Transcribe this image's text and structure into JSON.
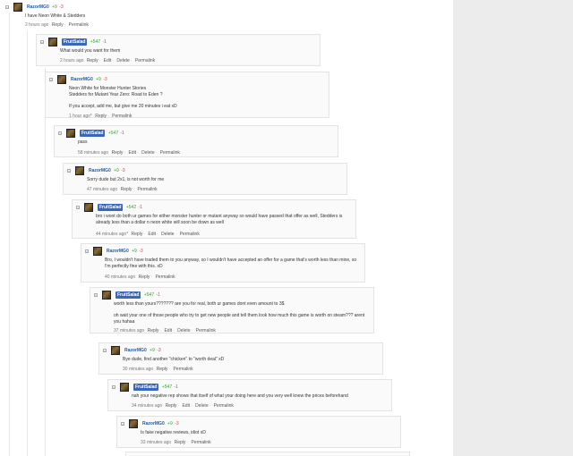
{
  "comments": [
    {
      "user": "RazorMG0",
      "pos": "+9",
      "neg": "-3",
      "text": [
        "I have Neon White & Stedders"
      ],
      "time": "2 hours ago",
      "actions": [
        "Reply",
        "Permalink"
      ]
    },
    {
      "user": "FruitSalad",
      "pos": "+547",
      "neg": "-1",
      "text": [
        "What would you want for them"
      ],
      "time": "2 hours ago",
      "actions": [
        "Reply",
        "Edit",
        "Delete",
        "Permalink"
      ]
    },
    {
      "user": "RazorMG0",
      "pos": "+9",
      "neg": "-3",
      "text": [
        "Neon White for Monster Hunter Stories",
        "Stedders for Mutant Year Zero: Road to Eden ?",
        "",
        "If you accept, add me, but give me 20 minutes i eat xD"
      ],
      "time": "1 hour ago*",
      "actions": [
        "Reply",
        "Permalink"
      ]
    },
    {
      "user": "FruitSalad",
      "pos": "+547",
      "neg": "-1",
      "text": [
        "pass"
      ],
      "time": "58 minutes ago",
      "actions": [
        "Reply",
        "Edit",
        "Delete",
        "Permalink"
      ]
    },
    {
      "user": "RazorMG0",
      "pos": "+9",
      "neg": "-3",
      "text": [
        "Sorry dude but 2x1, is not worth for me"
      ],
      "time": "47 minutes ago",
      "actions": [
        "Reply",
        "Permalink"
      ]
    },
    {
      "user": "FruitSalad",
      "pos": "+542",
      "neg": "-1",
      "text": [
        "bro i wont do both ur games for either monster hunter or mutant anyway so would have passed that offer as well, Stedders is already less than a dollar n neon white will soon be down as well"
      ],
      "time": "44 minutes ago*",
      "actions": [
        "Reply",
        "Edit",
        "Delete",
        "Permalink"
      ]
    },
    {
      "user": "RazorMG0",
      "pos": "+9",
      "neg": "-3",
      "text": [
        "Bro, I wouldn't have traded them to you anyway, so I wouldn't have accepted an offer for a game that's worth less than mine, so I'm perfectly fine with this. xD"
      ],
      "time": "40 minutes ago",
      "actions": [
        "Reply",
        "Permalink"
      ]
    },
    {
      "user": "FruitSalad",
      "pos": "+547",
      "neg": "-1",
      "text": [
        "worth less than yours??????? are you for real, both ur games dont even amount to 3$",
        "",
        "oh wait your one of those people who try to get new people and tell them look how much this game is worth on steam??? arent you hahaa"
      ],
      "time": "37 minutes ago",
      "actions": [
        "Reply",
        "Edit",
        "Delete",
        "Permalink"
      ]
    },
    {
      "user": "RazorMG0",
      "pos": "+9",
      "neg": "-3",
      "text": [
        "Bye dude, find another \"chicken\" to \"worth deal\" xD"
      ],
      "time": "30 minutes ago",
      "actions": [
        "Reply",
        "Permalink"
      ]
    },
    {
      "user": "FruitSalad",
      "pos": "+547",
      "neg": "-1",
      "text": [
        "nah your negative rep shows that itself of what your doing here and you very well knew the prices beforehand"
      ],
      "time": "34 minutes ago",
      "actions": [
        "Reply",
        "Edit",
        "Delete",
        "Permalink"
      ]
    },
    {
      "user": "RazorMG0",
      "pos": "+9",
      "neg": "-3",
      "text": [
        "Is fake negative reviews, idiot xD"
      ],
      "time": "33 minutes ago",
      "actions": [
        "Reply",
        "Permalink"
      ]
    }
  ]
}
